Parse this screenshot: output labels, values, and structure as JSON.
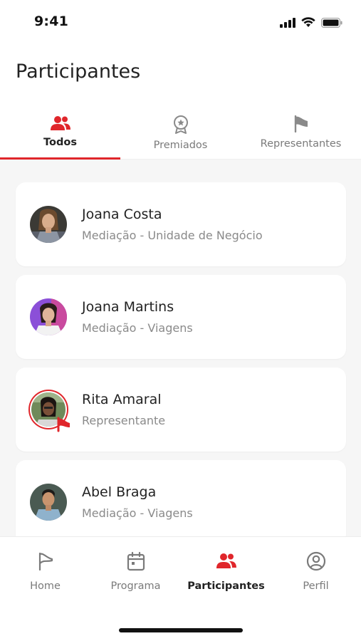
{
  "status_bar": {
    "time": "9:41"
  },
  "page_title": "Participantes",
  "tabs": [
    {
      "label": "Todos",
      "icon": "people-icon",
      "active": true
    },
    {
      "label": "Premiados",
      "icon": "award-icon",
      "active": false
    },
    {
      "label": "Representantes",
      "icon": "flag-icon",
      "active": false
    }
  ],
  "participants": [
    {
      "name": "Joana Costa",
      "role": "Mediação - Unidade de Negócio"
    },
    {
      "name": "Joana Martins",
      "role": "Mediação - Viagens"
    },
    {
      "name": "Rita Amaral",
      "role": "Representante",
      "representative": true
    },
    {
      "name": "Abel Braga",
      "role": "Mediação - Viagens"
    }
  ],
  "bottom_nav": [
    {
      "label": "Home",
      "icon": "flag-outline-icon",
      "active": false
    },
    {
      "label": "Programa",
      "icon": "calendar-icon",
      "active": false
    },
    {
      "label": "Participantes",
      "icon": "people-icon",
      "active": true
    },
    {
      "label": "Perfil",
      "icon": "user-circle-icon",
      "active": false
    }
  ],
  "colors": {
    "accent": "#e0262b",
    "background": "#f6f6f6",
    "text": "#222222",
    "muted": "#8a8a8a"
  }
}
